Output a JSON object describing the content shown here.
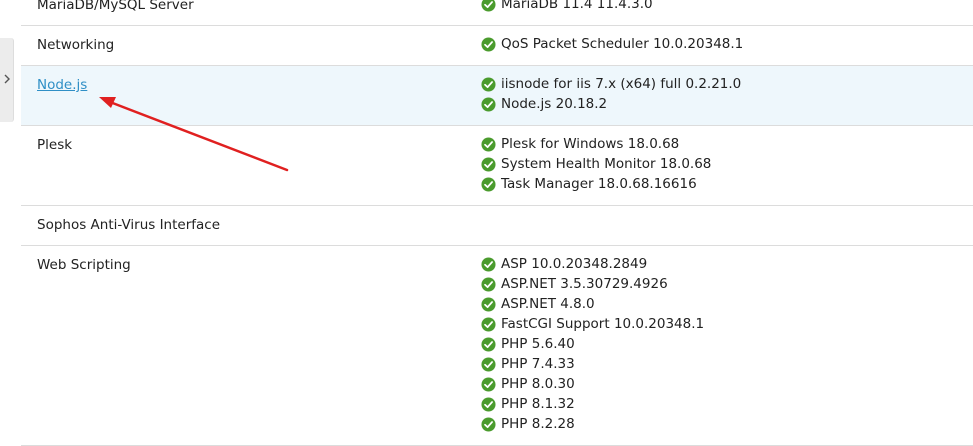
{
  "colors": {
    "ok_green": "#4a9b2d",
    "link_blue": "#2f8fc6",
    "highlight_row": "#eef7fc",
    "annotation_red": "#e02020"
  },
  "sidebar_toggle": {
    "icon": "chevron-right-icon"
  },
  "rows": [
    {
      "name": "MariaDB/MySQL Server",
      "is_link": false,
      "components": [
        "MariaDB 11.4 11.4.3.0"
      ]
    },
    {
      "name": "Networking",
      "is_link": false,
      "components": [
        "QoS Packet Scheduler 10.0.20348.1"
      ]
    },
    {
      "name": "Node.js",
      "is_link": true,
      "highlighted": true,
      "components": [
        "iisnode for iis 7.x (x64) full 0.2.21.0",
        "Node.js 20.18.2"
      ]
    },
    {
      "name": "Plesk",
      "is_link": false,
      "components": [
        "Plesk for Windows 18.0.68",
        "System Health Monitor 18.0.68",
        "Task Manager 18.0.68.16616"
      ]
    },
    {
      "name": "Sophos Anti-Virus Interface",
      "is_link": false,
      "components": []
    },
    {
      "name": "Web Scripting",
      "is_link": false,
      "components": [
        "ASP 10.0.20348.2849",
        "ASP.NET 3.5.30729.4926",
        "ASP.NET 4.8.0",
        "FastCGI Support 10.0.20348.1",
        "PHP 5.6.40",
        "PHP 7.4.33",
        "PHP 8.0.30",
        "PHP 8.1.32",
        "PHP 8.2.28"
      ]
    }
  ],
  "annotation": {
    "type": "red-arrow",
    "points_to": "Node.js"
  }
}
